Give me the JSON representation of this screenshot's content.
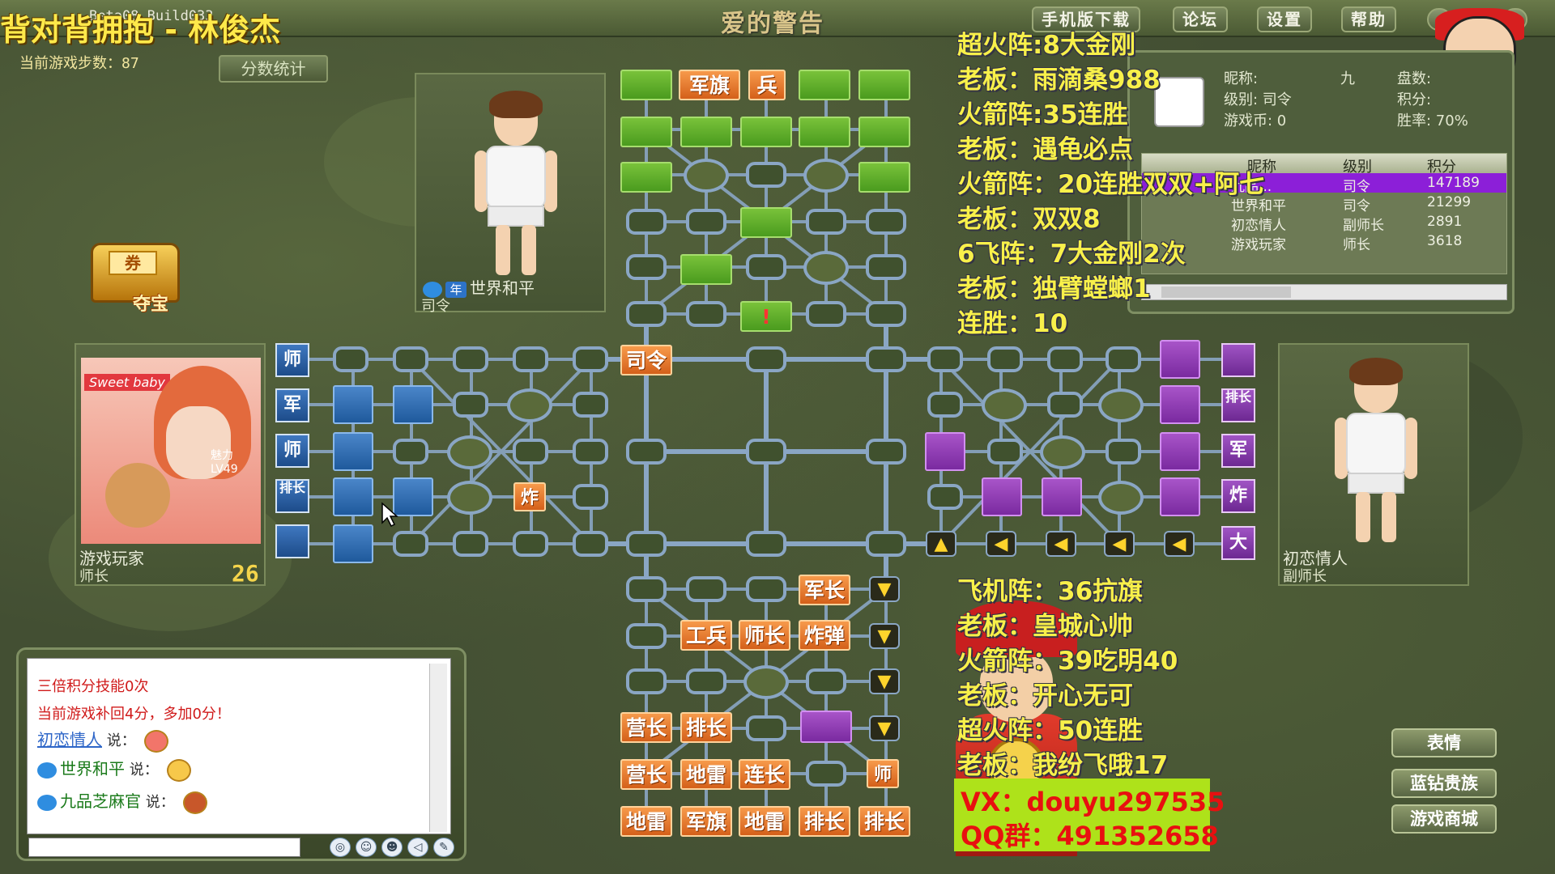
{
  "window": {
    "title": "Beta08 Build033",
    "app_name": "爱的警告",
    "top_buttons": [
      "手机版下载",
      "论坛",
      "设置",
      "帮助"
    ],
    "minimize": "–",
    "close": "×"
  },
  "stream": {
    "title": "背对背拥抱 - 林俊杰"
  },
  "game": {
    "step_label": "当前游戏步数：87",
    "score_stats_button": "分数统计",
    "treasure_ticket": "券",
    "treasure_label": "夺宝"
  },
  "players": {
    "top": {
      "name": "世界和平",
      "rank": "司令",
      "badge1": "钻",
      "badge2": "年"
    },
    "left": {
      "name": "游戏玩家",
      "rank": "师长",
      "number": "26",
      "avatar_text": "Sweet baby",
      "level": "LV49",
      "charm": "魅力"
    },
    "right": {
      "name": "初恋情人",
      "rank": "副师长"
    }
  },
  "info_panel": {
    "nick_label": "昵称:",
    "nick_value": "九",
    "level_label": "级别: 司令",
    "coin_label": "游戏币: 0",
    "rounds_label": "盘数:",
    "points_label": "积分:",
    "winrate_label": "胜率: 70%",
    "rank_headers": [
      "昵称",
      "级别",
      "积分"
    ],
    "rank_rows": [
      {
        "name": "九品...",
        "level": "司令",
        "score": "147189"
      },
      {
        "name": "世界和平",
        "level": "司令",
        "score": "21299"
      },
      {
        "name": "初恋情人",
        "level": "副师长",
        "score": "2891"
      },
      {
        "name": "游戏玩家",
        "level": "师长",
        "score": "3618"
      }
    ]
  },
  "overlay_top": [
    "超火阵:8大金刚",
    "老板：雨滴桑988",
    "火箭阵:35连胜",
    "老板：遇龟必点",
    "火箭阵：20连胜双双+阿七",
    "老板：双双8",
    "6飞阵：7大金刚2次",
    "老板：独臂螳螂1",
    "连胜：10"
  ],
  "overlay_bottom": [
    "飞机阵：36抗旗",
    "老板：皇城心帅",
    "火箭阵：39吃明40",
    "老板：开心无可",
    "超火阵：50连胜",
    "老板：我纷飞哦17"
  ],
  "contact": {
    "vx": "VX：douyu297535",
    "qq": "QQ群：491352658"
  },
  "board": {
    "top_pieces": [
      "军旗",
      "兵",
      "!"
    ],
    "left_tags": [
      "师",
      "军",
      "师",
      "排长",
      ""
    ],
    "left_piece": "炸",
    "right_tags": [
      "",
      "排长",
      "军",
      "炸",
      "大"
    ],
    "center_piece": "司令",
    "arrow_down": "▼",
    "arrow_left": "◀",
    "arrow_tr": "▲",
    "bottom_rows": [
      [
        "",
        "",
        "",
        "军长",
        ""
      ],
      [
        "",
        "工兵",
        "师长",
        "炸弹",
        ""
      ],
      [
        "",
        "",
        "",
        "",
        ""
      ],
      [
        "营长",
        "排长",
        "",
        "",
        ""
      ],
      [
        "营长",
        "地雷",
        "连长",
        "",
        "师"
      ],
      [
        "地雷",
        "军旗",
        "地雷",
        "排长",
        "排长"
      ]
    ]
  },
  "chat": {
    "lines": [
      {
        "text": "三倍积分技能0次",
        "color": "#d01a1a"
      },
      {
        "text": "当前游戏补回4分，多加0分！",
        "color": "#d01a1a"
      }
    ],
    "messages": [
      {
        "user": "初恋情人",
        "say": "说："
      },
      {
        "user": "世界和平",
        "say": "说："
      },
      {
        "user": "九品芝麻官",
        "say": "说："
      }
    ],
    "tools": [
      "◎",
      "☺",
      "☻",
      "◁",
      "✎",
      "✪"
    ]
  },
  "right_buttons": [
    "表情",
    "蓝钻贵族",
    "游戏商城"
  ],
  "colors": {
    "accent_yellow": "#f8f04a",
    "contact_bg": "#aee21a",
    "contact_text": "#e81010",
    "selected_row": "#8c1fd8"
  }
}
